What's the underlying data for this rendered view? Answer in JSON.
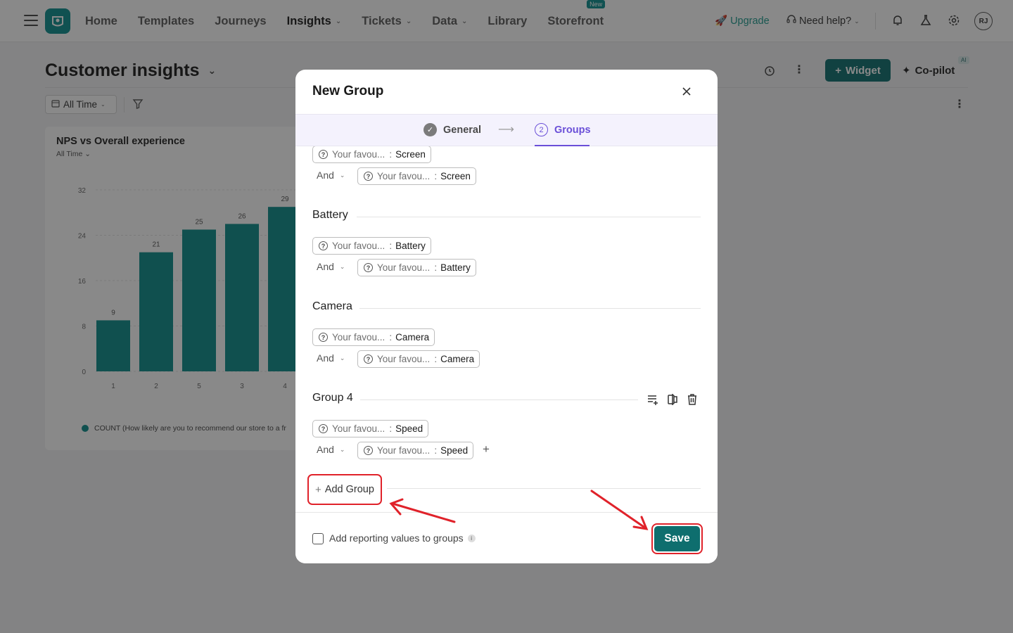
{
  "nav": {
    "items": [
      {
        "label": "Home",
        "dropdown": false,
        "active": false
      },
      {
        "label": "Templates",
        "dropdown": false,
        "active": false
      },
      {
        "label": "Journeys",
        "dropdown": false,
        "active": false
      },
      {
        "label": "Insights",
        "dropdown": true,
        "active": true
      },
      {
        "label": "Tickets",
        "dropdown": true,
        "active": false
      },
      {
        "label": "Data",
        "dropdown": true,
        "active": false
      },
      {
        "label": "Library",
        "dropdown": false,
        "active": false
      },
      {
        "label": "Storefront",
        "dropdown": false,
        "active": false,
        "badge": "New"
      }
    ],
    "upgrade": "Upgrade",
    "need_help": "Need help?",
    "avatar": "RJ"
  },
  "page": {
    "title": "Customer insights",
    "widget_button": "Widget",
    "copilot": "Co-pilot",
    "ai_badge": "AI",
    "date_filter": "All Time"
  },
  "chart_card": {
    "title": "NPS vs Overall experience",
    "subtitle": "All Time",
    "legend": "COUNT (How likely are you to recommend our store to a fr"
  },
  "chart_data": {
    "type": "bar",
    "categories": [
      "1",
      "2",
      "5",
      "3",
      "4"
    ],
    "values": [
      9,
      21,
      25,
      26,
      29
    ],
    "ylim": [
      0,
      32
    ],
    "yticks": [
      0,
      8,
      16,
      24,
      32
    ],
    "color": "#0d8d8b",
    "grid": true,
    "series": [
      {
        "name": "COUNT (How likely are you to recommend our store to a fr",
        "values": [
          9,
          21,
          25,
          26,
          29
        ]
      }
    ]
  },
  "modal": {
    "title": "New Group",
    "steps": [
      {
        "label": "General",
        "state": "done"
      },
      {
        "label": "Groups",
        "number": "2",
        "state": "active"
      }
    ],
    "connector": "And",
    "groups": [
      {
        "name": "",
        "conditions": [
          {
            "field": "Your favou...",
            "value": "Screen"
          },
          {
            "field": "Your favou...",
            "value": "Screen"
          }
        ]
      },
      {
        "name": "Battery",
        "conditions": [
          {
            "field": "Your favou...",
            "value": "Battery"
          },
          {
            "field": "Your favou...",
            "value": "Battery"
          }
        ]
      },
      {
        "name": "Camera",
        "conditions": [
          {
            "field": "Your favou...",
            "value": "Camera"
          },
          {
            "field": "Your favou...",
            "value": "Camera"
          }
        ]
      },
      {
        "name": "Group 4",
        "conditions": [
          {
            "field": "Your favou...",
            "value": "Speed"
          },
          {
            "field": "Your favou...",
            "value": "Speed"
          }
        ]
      }
    ],
    "add_group": "Add Group",
    "checkbox_label": "Add reporting values to groups",
    "checkbox_checked": false,
    "save": "Save"
  },
  "colors": {
    "accent": "#0e6e6e",
    "bar": "#0d8d8b",
    "step_active": "#6a4fd8",
    "annotation": "#e0222a"
  }
}
